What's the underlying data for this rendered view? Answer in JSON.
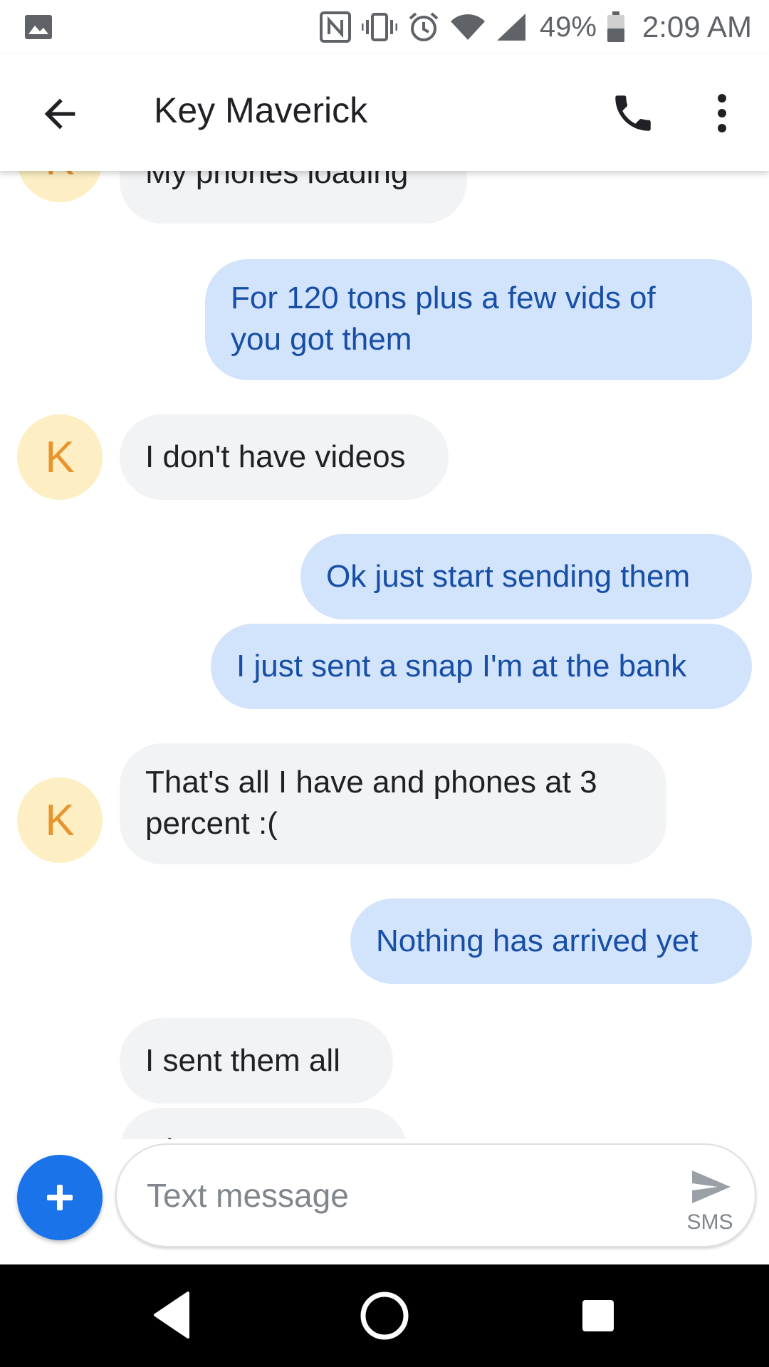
{
  "status_bar": {
    "battery_percent": "49%",
    "time": "2:09 AM",
    "icons": [
      "gallery-icon",
      "nfc-icon",
      "vibrate-icon",
      "alarm-icon",
      "wifi-icon",
      "signal-icon",
      "battery-icon"
    ]
  },
  "header": {
    "contact_name": "Key Maverick",
    "icons": [
      "back-arrow-icon",
      "phone-icon",
      "more-vert-icon"
    ]
  },
  "messages": [
    {
      "direction": "incoming",
      "avatar": "K",
      "lines": [
        "My phones loading"
      ]
    },
    {
      "direction": "outgoing",
      "lines": [
        "For 120 tons plus a few vids of",
        "you got them"
      ]
    },
    {
      "direction": "incoming",
      "avatar": "K",
      "lines": [
        "I don't have videos"
      ]
    },
    {
      "direction": "outgoing",
      "lines": [
        "Ok just start sending them"
      ]
    },
    {
      "direction": "outgoing",
      "lines": [
        "I just sent a snap I'm at the bank"
      ]
    },
    {
      "direction": "incoming",
      "avatar": "K",
      "lines": [
        "That's all I have and phones at 3",
        "percent :("
      ]
    },
    {
      "direction": "outgoing",
      "lines": [
        "Nothing has arrived yet"
      ]
    },
    {
      "direction": "incoming",
      "lines": [
        "I sent them all"
      ]
    },
    {
      "direction": "incoming",
      "lines": [
        "Pl..."
      ]
    }
  ],
  "compose": {
    "placeholder": "Text message",
    "send_type": "SMS"
  },
  "colors": {
    "incoming_bubble": "#f1f3f4",
    "outgoing_bubble": "#d2e3fc",
    "outgoing_text": "#174ea6",
    "avatar_bg": "#fdefc3",
    "avatar_letter": "#e8952f",
    "fab": "#1a73e8"
  }
}
